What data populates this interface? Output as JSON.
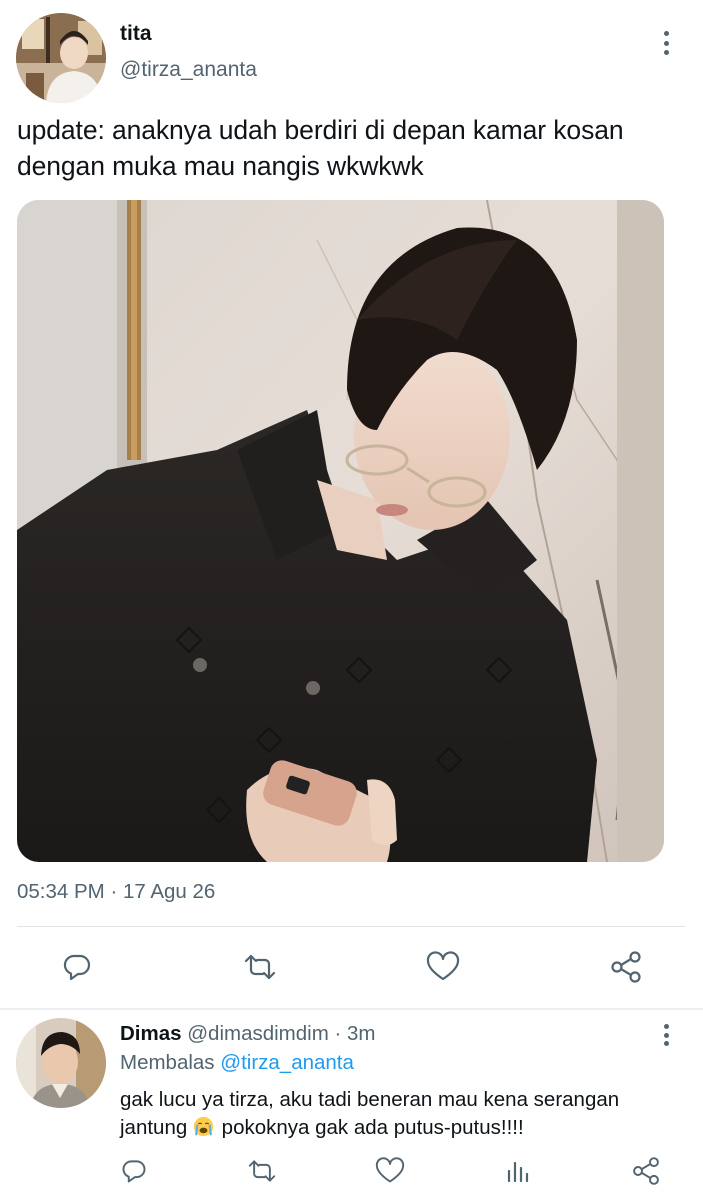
{
  "main_tweet": {
    "display_name": "tita",
    "handle": "@tirza_ananta",
    "text": "update: anaknya udah berdiri di depan kamar kosan dengan muka mau nangis wkwkwk",
    "timestamp": "05:34 PM · 17 Agu 26",
    "actions": [
      "reply-icon",
      "retweet-icon",
      "like-icon",
      "share-icon"
    ]
  },
  "reply": {
    "display_name": "Dimas",
    "handle": "@dimasdimdim",
    "dot": "·",
    "time": "3m",
    "replying_label": "Membalas",
    "replying_to": "@tirza_ananta",
    "text_before_emoji": "gak lucu ya tirza, aku tadi beneran mau kena serangan jantung",
    "emoji": "😭",
    "text_after_emoji": "pokoknya gak ada putus-putus!!!!",
    "actions": [
      "reply-icon",
      "retweet-icon",
      "like-icon",
      "stats-icon",
      "share-icon"
    ]
  },
  "colors": {
    "text_primary": "#0f1419",
    "text_secondary": "#536471",
    "link": "#1d9bf0",
    "divider": "#e1e5e8"
  }
}
